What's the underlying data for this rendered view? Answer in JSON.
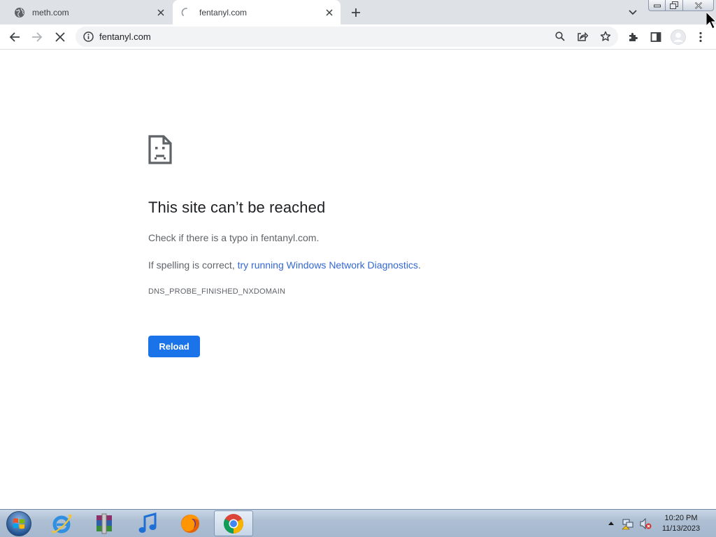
{
  "tabs": [
    {
      "title": "meth.com",
      "favicon": "globe-icon",
      "active": false
    },
    {
      "title": "fentanyl.com",
      "favicon": "loading-spinner-icon",
      "active": true
    }
  ],
  "omnibox": {
    "url": "fentanyl.com"
  },
  "error": {
    "title": "This site can’t be reached",
    "line1": "Check if there is a typo in fentanyl.com.",
    "line2_prefix": "If spelling is correct, ",
    "line2_link": "try running Windows Network Diagnostics",
    "line2_suffix": ".",
    "code": "DNS_PROBE_FINISHED_NXDOMAIN",
    "reload_label": "Reload"
  },
  "taskbar": {
    "apps": [
      "internet-explorer-icon",
      "winrar-icon",
      "itunes-icon",
      "firefox-icon",
      "chrome-icon"
    ],
    "active_app": "chrome-icon",
    "clock_time": "10:20 PM",
    "clock_date": "11/13/2023"
  },
  "colors": {
    "accent": "#1a73e8",
    "tabstrip": "#dee1e6",
    "omnibox": "#f1f3f4"
  }
}
